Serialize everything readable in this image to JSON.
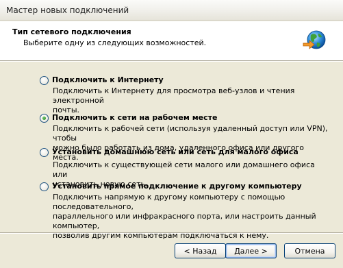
{
  "window": {
    "title": "Мастер новых подключений"
  },
  "header": {
    "title": "Тип сетевого подключения",
    "subtitle": "Выберите одну из следующих возможностей.",
    "icon": "globe-connection-icon"
  },
  "options": [
    {
      "label": "Подключить к Интернету",
      "desc_lines": [
        "Подключить к Интернету для просмотра веб-узлов и чтения  электронной",
        "почты."
      ],
      "selected": false
    },
    {
      "label": "Подключить к сети на рабочем месте",
      "desc_lines": [
        "Подключить к рабочей сети (используя удаленный доступ или VPN), чтобы",
        "можно было работать из дома, удаленного офиса или другого места."
      ],
      "selected": true
    },
    {
      "label": "Установить домашнюю сеть или сеть для малого офиса",
      "desc_lines": [
        "Подключить к существующей сети малого или домашнего офиса или",
        "установить новую сеть."
      ],
      "selected": false
    },
    {
      "label": "Установить прямое подключение к другому компьютеру",
      "desc_lines": [
        "Подключить напрямую к другому компьютеру с помощью последовательного,",
        "параллельного или инфракрасного порта, или настроить данный компьютер,",
        "позволив другим  компьютерам подключаться к нему."
      ],
      "selected": false
    }
  ],
  "buttons": {
    "back": "< Назад",
    "next": "Далее >",
    "cancel": "Отмена"
  }
}
